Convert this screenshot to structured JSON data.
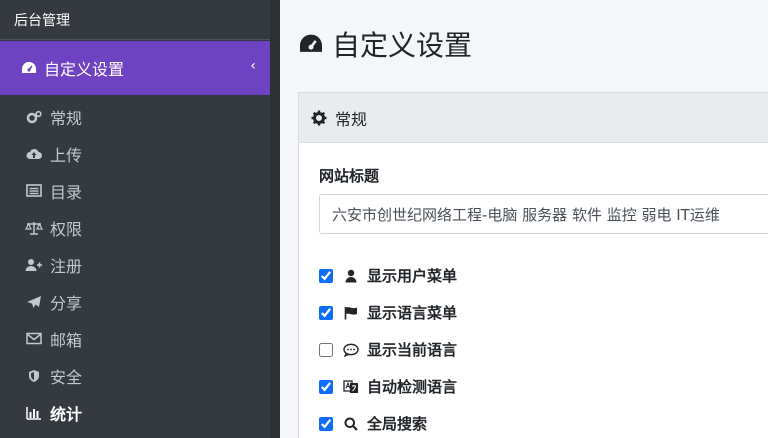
{
  "sidebar": {
    "brand": "后台管理",
    "section": {
      "label": "自定义设置",
      "icon": "gauge-icon"
    },
    "items": [
      {
        "label": "常规",
        "icon": "gears-icon"
      },
      {
        "label": "上传",
        "icon": "cloud-upload-icon"
      },
      {
        "label": "目录",
        "icon": "list-icon"
      },
      {
        "label": "权限",
        "icon": "balance-scale-icon"
      },
      {
        "label": "注册",
        "icon": "user-plus-icon"
      },
      {
        "label": "分享",
        "icon": "paper-plane-icon"
      },
      {
        "label": "邮箱",
        "icon": "envelope-icon"
      },
      {
        "label": "安全",
        "icon": "shield-icon"
      },
      {
        "label": "统计",
        "icon": "bar-chart-icon",
        "active": true
      }
    ]
  },
  "page": {
    "title": "自定义设置",
    "card": {
      "header": "常规",
      "site_title_label": "网站标题",
      "site_title_value": "六安市创世纪网络工程-电脑 服务器 软件 监控 弱电 IT运维",
      "checkboxes": [
        {
          "label": "显示用户菜单",
          "checked": true,
          "icon": "user-icon"
        },
        {
          "label": "显示语言菜单",
          "checked": true,
          "icon": "flag-icon"
        },
        {
          "label": "显示当前语言",
          "checked": false,
          "icon": "comment-dots-icon"
        },
        {
          "label": "自动检测语言",
          "checked": true,
          "icon": "language-icon"
        },
        {
          "label": "全局搜索",
          "checked": true,
          "icon": "search-icon"
        }
      ]
    }
  },
  "colors": {
    "sidebar_bg": "#343a40",
    "active_menu": "#6f42c1",
    "content_bg": "#f4f6f9",
    "card_header_bg": "#e9ecef",
    "checkbox": "#0d6efd"
  }
}
